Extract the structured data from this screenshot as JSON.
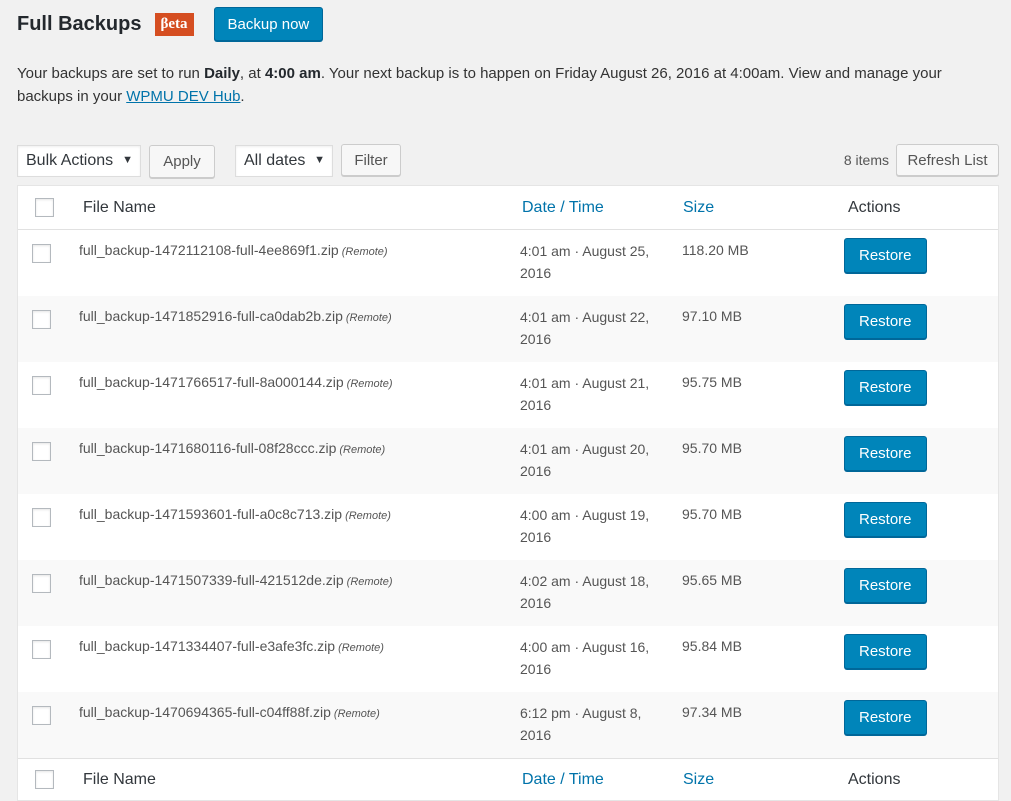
{
  "header": {
    "title": "Full Backups",
    "beta_label": "βeta",
    "backup_now_label": "Backup now"
  },
  "description": {
    "part1": "Your backups are set to run ",
    "frequency": "Daily",
    "part2": ", at ",
    "time": "4:00 am",
    "part3": ". Your next backup is to happen on Friday August 26, 2016 at 4:00am. View and manage your backups in your ",
    "link_text": "WPMU DEV Hub",
    "part4": "."
  },
  "toolbar": {
    "bulk_actions": "Bulk Actions",
    "apply_label": "Apply",
    "dates_filter": "All dates",
    "filter_label": "Filter",
    "items_count": "8 items",
    "refresh_label": "Refresh List"
  },
  "columns": {
    "file_name": "File Name",
    "date_time": "Date / Time",
    "size": "Size",
    "actions": "Actions"
  },
  "rows": [
    {
      "file": "full_backup-1472112108-full-4ee869f1.zip",
      "remote": "(Remote)",
      "date_line1": "4:01 am · August 25,",
      "date_line2": "2016",
      "size": "118.20 MB",
      "action": "Restore"
    },
    {
      "file": "full_backup-1471852916-full-ca0dab2b.zip",
      "remote": "(Remote)",
      "date_line1": "4:01 am · August 22,",
      "date_line2": "2016",
      "size": "97.10 MB",
      "action": "Restore"
    },
    {
      "file": "full_backup-1471766517-full-8a000144.zip",
      "remote": "(Remote)",
      "date_line1": "4:01 am · August 21,",
      "date_line2": "2016",
      "size": "95.75 MB",
      "action": "Restore"
    },
    {
      "file": "full_backup-1471680116-full-08f28ccc.zip",
      "remote": "(Remote)",
      "date_line1": "4:01 am · August 20,",
      "date_line2": "2016",
      "size": "95.70 MB",
      "action": "Restore"
    },
    {
      "file": "full_backup-1471593601-full-a0c8c713.zip",
      "remote": "(Remote)",
      "date_line1": "4:00 am · August 19,",
      "date_line2": "2016",
      "size": "95.70 MB",
      "action": "Restore"
    },
    {
      "file": "full_backup-1471507339-full-421512de.zip",
      "remote": "(Remote)",
      "date_line1": "4:02 am · August 18,",
      "date_line2": "2016",
      "size": "95.65 MB",
      "action": "Restore"
    },
    {
      "file": "full_backup-1471334407-full-e3afe3fc.zip",
      "remote": "(Remote)",
      "date_line1": "4:00 am · August 16,",
      "date_line2": "2016",
      "size": "95.84 MB",
      "action": "Restore"
    },
    {
      "file": "full_backup-1470694365-full-c04ff88f.zip",
      "remote": "(Remote)",
      "date_line1": "6:12 pm · August 8,",
      "date_line2": "2016",
      "size": "97.34 MB",
      "action": "Restore"
    }
  ],
  "colors": {
    "primary": "#0085ba",
    "link": "#0073aa",
    "beta_badge": "#d54e21"
  }
}
